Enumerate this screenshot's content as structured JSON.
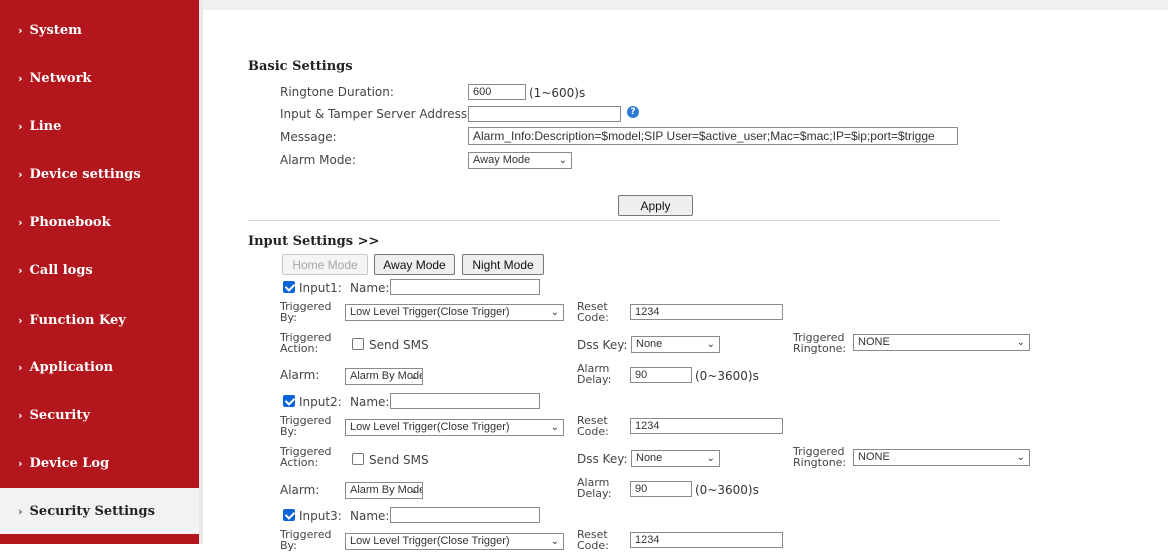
{
  "sidebar": {
    "items": [
      {
        "label": "System"
      },
      {
        "label": "Network"
      },
      {
        "label": "Line"
      },
      {
        "label": "Device settings"
      },
      {
        "label": "Phonebook"
      },
      {
        "label": "Call logs"
      },
      {
        "label": "Function Key"
      },
      {
        "label": "Application"
      },
      {
        "label": "Security"
      },
      {
        "label": "Device Log"
      },
      {
        "label": "Security Settings",
        "active": true
      }
    ]
  },
  "basic": {
    "title": "Basic Settings",
    "ringtone_label": "Ringtone Duration:",
    "ringtone_value": "600",
    "ringtone_range": "(1~600)s",
    "server_label": "Input & Tamper Server Address:",
    "server_value": "",
    "help_glyph": "?",
    "message_label": "Message:",
    "message_value": "Alarm_Info:Description=$model;SIP User=$active_user;Mac=$mac;IP=$ip;port=$trigge",
    "alarm_mode_label": "Alarm Mode:",
    "alarm_mode_value": "Away Mode",
    "apply_label": "Apply"
  },
  "input_settings": {
    "title": "Input Settings >>",
    "mode_buttons": [
      "Home Mode",
      "Away Mode",
      "Night Mode"
    ],
    "inputs": [
      {
        "checkbox_label": "Input1:",
        "name_label": "Name:",
        "name_value": "",
        "triggered_by_label": [
          "Triggered",
          "By:"
        ],
        "triggered_by_value": "Low Level Trigger(Close Trigger)",
        "reset_label": [
          "Reset",
          "Code:"
        ],
        "reset_value": "1234",
        "triggered_action_label": [
          "Triggered",
          "Action:"
        ],
        "send_sms_label": "Send SMS",
        "dss_label": "Dss Key:",
        "dss_value": "None",
        "ringtone_label": [
          "Triggered",
          "Ringtone:"
        ],
        "ringtone_value": "NONE",
        "alarm_label": "Alarm:",
        "alarm_value": "Alarm By Mode",
        "alarm_delay_label": [
          "Alarm",
          "Delay:"
        ],
        "alarm_delay_value": "90",
        "alarm_delay_range": "(0~3600)s"
      },
      {
        "checkbox_label": "Input2:",
        "name_label": "Name:",
        "name_value": "",
        "triggered_by_label": [
          "Triggered",
          "By:"
        ],
        "triggered_by_value": "Low Level Trigger(Close Trigger)",
        "reset_label": [
          "Reset",
          "Code:"
        ],
        "reset_value": "1234",
        "triggered_action_label": [
          "Triggered",
          "Action:"
        ],
        "send_sms_label": "Send SMS",
        "dss_label": "Dss Key:",
        "dss_value": "None",
        "ringtone_label": [
          "Triggered",
          "Ringtone:"
        ],
        "ringtone_value": "NONE",
        "alarm_label": "Alarm:",
        "alarm_value": "Alarm By Mode",
        "alarm_delay_label": [
          "Alarm",
          "Delay:"
        ],
        "alarm_delay_value": "90",
        "alarm_delay_range": "(0~3600)s"
      },
      {
        "checkbox_label": "Input3:",
        "name_label": "Name:",
        "name_value": "",
        "triggered_by_label": [
          "Triggered",
          "By:"
        ],
        "triggered_by_value": "Low Level Trigger(Close Trigger)",
        "reset_label": [
          "Reset",
          "Code:"
        ],
        "reset_value": "1234"
      }
    ]
  },
  "colors": {
    "sidebar_bg": "#b3171d",
    "active_item_bg": "#f2f2f2",
    "help_icon": "#2c7ad6",
    "checkbox_checked": "#0a64d8"
  }
}
